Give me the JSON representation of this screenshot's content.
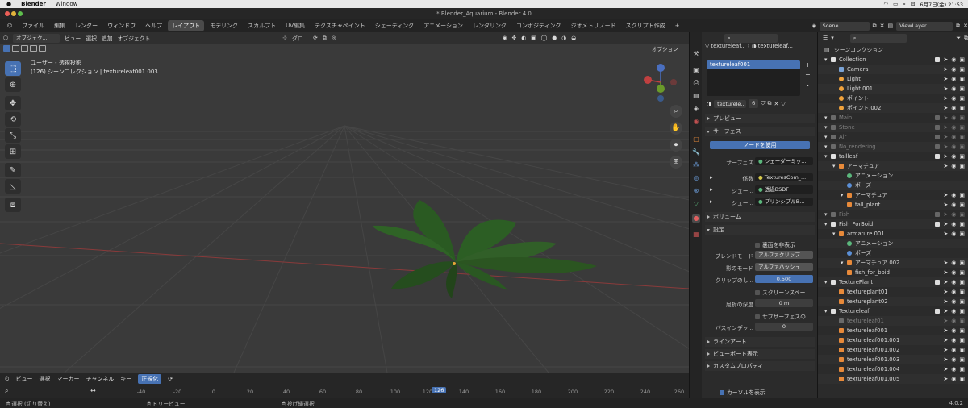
{
  "mac": {
    "app": "Blender",
    "menu": [
      "Window"
    ],
    "datetime": "6月7日(金) 21:53"
  },
  "window_title": "* Blender_Aquarium - Blender 4.0",
  "topmenu": [
    "ファイル",
    "編集",
    "レンダー",
    "ウィンドウ",
    "ヘルプ"
  ],
  "workspaces": [
    "レイアウト",
    "モデリング",
    "スカルプト",
    "UV編集",
    "テクスチャペイント",
    "シェーディング",
    "アニメーション",
    "レンダリング",
    "コンポジティング",
    "ジオメトリノード",
    "スクリプト作成"
  ],
  "active_workspace": "レイアウト",
  "scene": "Scene",
  "viewlayer": "ViewLayer",
  "viewport": {
    "mode": "オブジェク...",
    "menus": [
      "ビュー",
      "選択",
      "追加",
      "オブジェクト"
    ],
    "transform": "グロ...",
    "options": "オプション",
    "line1": "ユーザー・透視投影",
    "line2": "(126) シーンコレクション | textureleaf001.003"
  },
  "timeline": {
    "menus": [
      "ビュー",
      "選択",
      "マーカー",
      "チャンネル",
      "キー"
    ],
    "normalize": "正規化",
    "current_frame": "126",
    "ticks": [
      "-40",
      "-20",
      "0",
      "20",
      "40",
      "60",
      "80",
      "100",
      "120",
      "140",
      "160",
      "180",
      "200",
      "220",
      "240",
      "260"
    ]
  },
  "status": {
    "select": "選択 (切り替え)",
    "dolly": "ドリービュー",
    "lasso": "投げ縄選択",
    "version": "4.0.2"
  },
  "props": {
    "crumb_obj": "textureleaf...",
    "crumb_mat": "textureleaf...",
    "slot": "textureleaf001",
    "material": "texturele...",
    "users": "6",
    "sections": {
      "preview": "プレビュー",
      "surface": "サーフェス",
      "volume": "ボリューム",
      "settings": "設定",
      "lineart": "ラインアート",
      "viewport": "ビューポート表示",
      "custom": "カスタムプロパティ"
    },
    "use_nodes": "ノードを使用",
    "rows": [
      {
        "label": "サーフェス",
        "value": "シェーダーミッ..."
      },
      {
        "label": "係数",
        "value": "TexturesCom_..."
      },
      {
        "label": "シェー...",
        "value": "透過BSDF"
      },
      {
        "label": "シェー...",
        "value": "プリンシプルB..."
      }
    ],
    "backface": "裏面を非表示",
    "blend_label": "ブレンドモード",
    "blend_value": "アルファクリップ",
    "shadow_label": "影のモード",
    "shadow_value": "アルファハッシュ",
    "clip_label": "クリップのし...",
    "clip_value": "0.500",
    "screenspace": "スクリーンスペー...",
    "refr_label": "屈折の深度",
    "refr_value": "0 m",
    "subsurf": "サブサーフェスの...",
    "pass_label": "パスインデッ...",
    "pass_value": "0",
    "cursor_show": "カーソルを表示"
  },
  "outliner": {
    "title": "シーンコレクション",
    "rows": [
      {
        "label": "Collection",
        "type": "coll",
        "indent": 1
      },
      {
        "label": "Camera",
        "type": "cam",
        "indent": 2
      },
      {
        "label": "Light",
        "type": "light",
        "indent": 2
      },
      {
        "label": "Light.001",
        "type": "light",
        "indent": 2
      },
      {
        "label": "ポイント",
        "type": "light",
        "indent": 2
      },
      {
        "label": "ポイント.002",
        "type": "light",
        "indent": 2
      },
      {
        "label": "Main",
        "type": "coll",
        "indent": 1,
        "dim": true
      },
      {
        "label": "Stone",
        "type": "coll",
        "indent": 1,
        "dim": true
      },
      {
        "label": "Air",
        "type": "coll",
        "indent": 1,
        "dim": true
      },
      {
        "label": "No_rendering",
        "type": "coll",
        "indent": 1,
        "dim": true
      },
      {
        "label": "tallleaf",
        "type": "coll",
        "indent": 1
      },
      {
        "label": "アーマチュア",
        "type": "arm",
        "indent": 2
      },
      {
        "label": "アニメーション",
        "type": "anim",
        "indent": 3
      },
      {
        "label": "ポーズ",
        "type": "pose",
        "indent": 3
      },
      {
        "label": "アーマチュア",
        "type": "arm",
        "indent": 3
      },
      {
        "label": "tall_plant",
        "type": "mesh",
        "indent": 3
      },
      {
        "label": "Fish",
        "type": "coll",
        "indent": 1,
        "dim": true
      },
      {
        "label": "Fish_ForBoid",
        "type": "coll",
        "indent": 1
      },
      {
        "label": "armature.001",
        "type": "arm",
        "indent": 2
      },
      {
        "label": "アニメーション",
        "type": "anim",
        "indent": 3
      },
      {
        "label": "ポーズ",
        "type": "pose",
        "indent": 3
      },
      {
        "label": "アーマチュア.002",
        "type": "arm",
        "indent": 3
      },
      {
        "label": "fish_for_boid",
        "type": "mesh",
        "indent": 3
      },
      {
        "label": "TexturePlant",
        "type": "coll",
        "indent": 1
      },
      {
        "label": "textureplant01",
        "type": "mesh",
        "indent": 2
      },
      {
        "label": "textureplant02",
        "type": "mesh",
        "indent": 2
      },
      {
        "label": "Textureleaf",
        "type": "coll",
        "indent": 1
      },
      {
        "label": "textureleaf01",
        "type": "mesh",
        "indent": 2,
        "dim": true
      },
      {
        "label": "textureleaf001",
        "type": "mesh",
        "indent": 2
      },
      {
        "label": "textureleaf001.001",
        "type": "mesh",
        "indent": 2
      },
      {
        "label": "textureleaf001.002",
        "type": "mesh",
        "indent": 2
      },
      {
        "label": "textureleaf001.003",
        "type": "mesh",
        "indent": 2
      },
      {
        "label": "textureleaf001.004",
        "type": "mesh",
        "indent": 2
      },
      {
        "label": "textureleaf001.005",
        "type": "mesh",
        "indent": 2
      }
    ]
  },
  "colors": {
    "accent": "#4772b3",
    "collection": "#e0e0e0",
    "mesh": "#e88a3a",
    "light": "#f2a33c",
    "camera": "#7aa3d6",
    "armature": "#e88a3a",
    "anim": "#5bb77c"
  }
}
